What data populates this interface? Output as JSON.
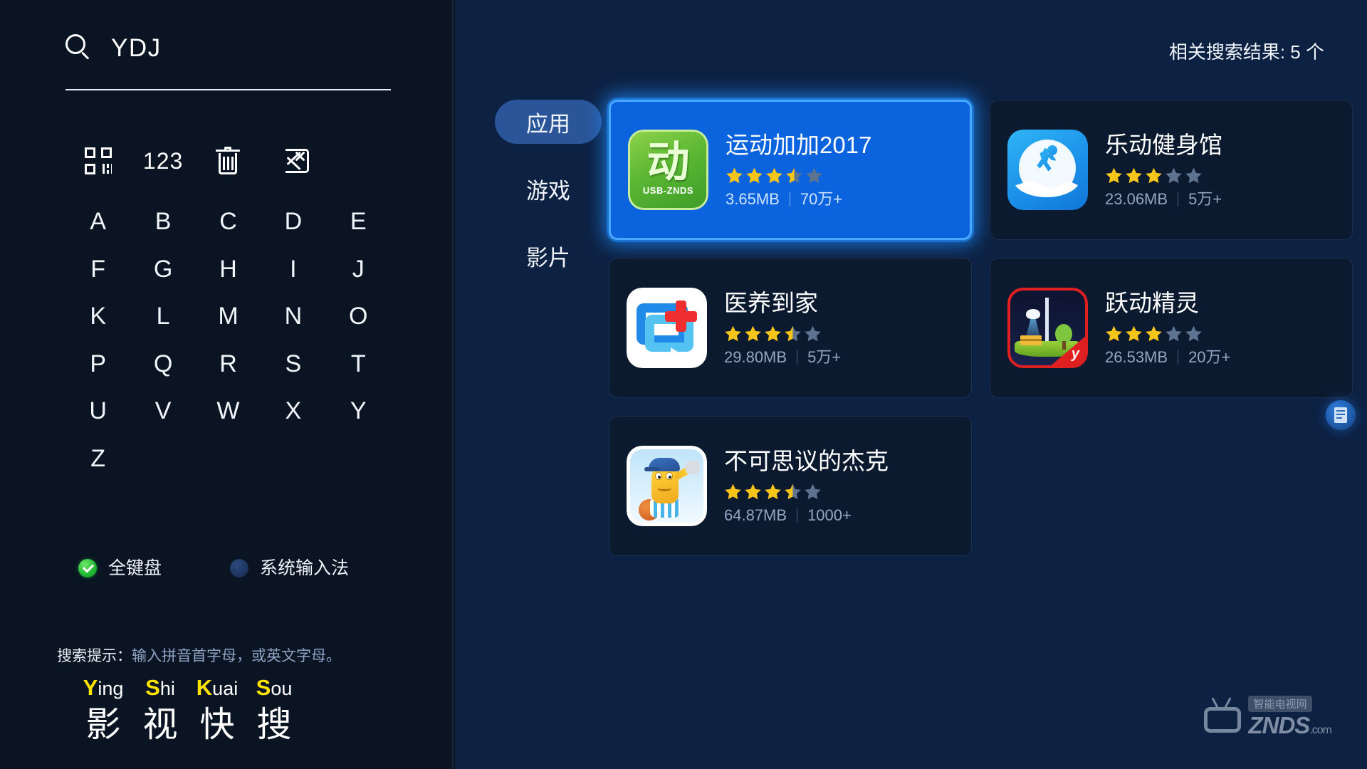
{
  "search": {
    "icon": "search-icon",
    "value": "YDJ",
    "placeholder": "YDJ"
  },
  "function_keys": [
    {
      "name": "qr-keyboard",
      "label": ""
    },
    {
      "name": "numeric",
      "label": "123"
    },
    {
      "name": "clear-all",
      "label": ""
    },
    {
      "name": "backspace",
      "label": ""
    }
  ],
  "keyboard": {
    "letters": [
      "A",
      "B",
      "C",
      "D",
      "E",
      "F",
      "G",
      "H",
      "I",
      "J",
      "K",
      "L",
      "M",
      "N",
      "O",
      "P",
      "Q",
      "R",
      "S",
      "T",
      "U",
      "V",
      "W",
      "X",
      "Y",
      "Z"
    ]
  },
  "input_modes": [
    {
      "label": "全键盘",
      "selected": true
    },
    {
      "label": "系统输入法",
      "selected": false
    }
  ],
  "hint": {
    "label": "搜索提示：",
    "text": "输入拼音首字母，或英文字母。"
  },
  "brand": {
    "pinyin": [
      {
        "cap": "Y",
        "rest": "ing"
      },
      {
        "cap": "S",
        "rest": "hi"
      },
      {
        "cap": "K",
        "rest": "uai"
      },
      {
        "cap": "S",
        "rest": "ou"
      }
    ],
    "chinese": [
      "影",
      "视",
      "快",
      "搜"
    ],
    "accent_color": "#ffe400"
  },
  "results": {
    "count_label": "相关搜索结果: 5 个",
    "categories": [
      {
        "label": "应用",
        "active": true
      },
      {
        "label": "游戏",
        "active": false
      },
      {
        "label": "影片",
        "active": false
      }
    ],
    "apps": [
      {
        "name": "运动加加2017",
        "rating": 3.5,
        "size": "3.65MB",
        "downloads": "70万+",
        "selected": true,
        "icon": "app-icon-yundong-jiajia",
        "icon_badge": "USB-ZNDS",
        "icon_glyph": "动"
      },
      {
        "name": "乐动健身馆",
        "rating": 3,
        "size": "23.06MB",
        "downloads": "5万+",
        "selected": false,
        "icon": "app-icon-ledong-fitness"
      },
      {
        "name": "医养到家",
        "rating": 3.5,
        "size": "29.80MB",
        "downloads": "5万+",
        "selected": false,
        "icon": "app-icon-yiyang-daojia"
      },
      {
        "name": "跃动精灵",
        "rating": 3,
        "size": "26.53MB",
        "downloads": "20万+",
        "selected": false,
        "icon": "app-icon-yuedong-jingling"
      },
      {
        "name": "不可思议的杰克",
        "rating": 3.5,
        "size": "64.87MB",
        "downloads": "1000+",
        "selected": false,
        "icon": "app-icon-incredible-jack"
      }
    ]
  },
  "watermark": {
    "cn_tag": "智能电视网",
    "main": "ZNDS",
    "suffix": ".com"
  },
  "colors": {
    "left_bg": "#0a1422",
    "right_bg": "#0d2142",
    "card_bg": "#0c1a30",
    "selected_card": "#0b63dd",
    "selected_glow": "#4aa9ff",
    "tab_active": "#2a5699",
    "star_on": "#f7c51a",
    "star_off": "#5d7390",
    "radio_on": "#22bb33"
  }
}
